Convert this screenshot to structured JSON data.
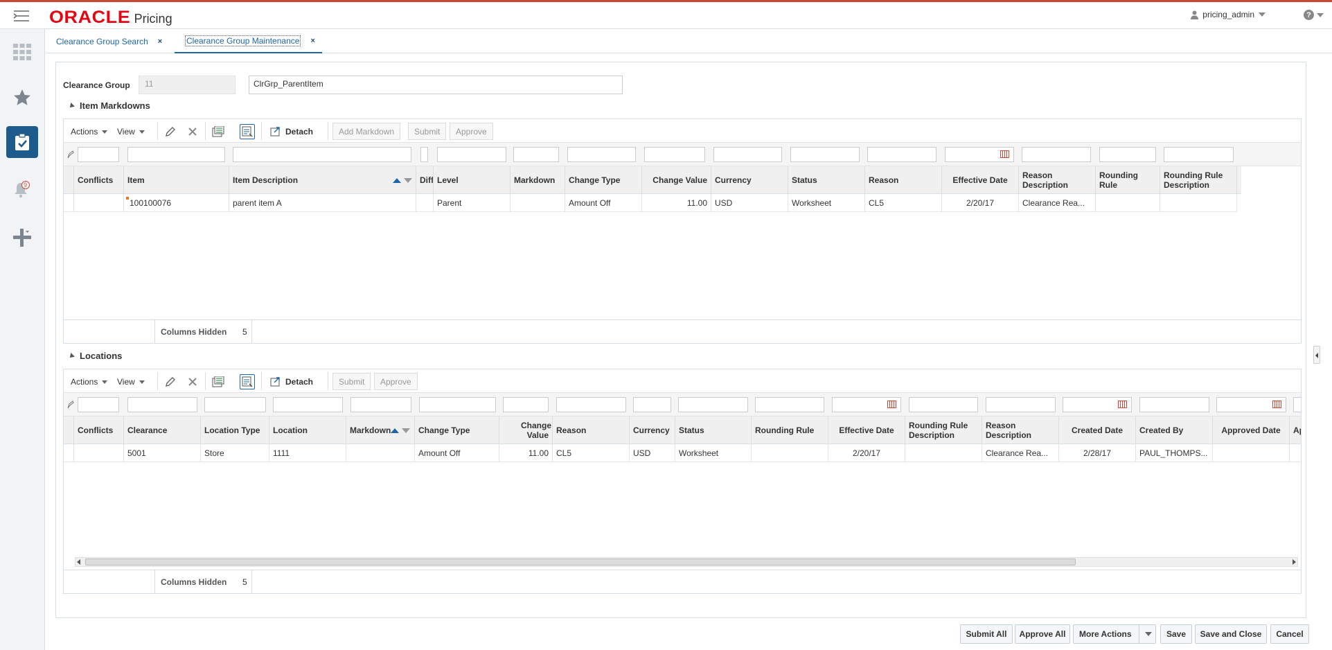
{
  "header": {
    "brand": "ORACLE",
    "app_name": "Pricing",
    "user": "pricing_admin",
    "help": "?"
  },
  "sidenav": {
    "notification_count": "9"
  },
  "tabs": [
    {
      "label": "Clearance Group Search",
      "close": "×"
    },
    {
      "label": "Clearance Group Maintenance",
      "close": "×"
    }
  ],
  "form": {
    "label": "Clearance Group",
    "id_value": "11",
    "name_value": "ClrGrp_ParentItem"
  },
  "item_markdowns": {
    "title": "Item Markdowns",
    "toolbar": {
      "actions": "Actions",
      "view": "View",
      "detach": "Detach",
      "add_markdown": "Add Markdown",
      "submit": "Submit",
      "approve": "Approve"
    },
    "columns": [
      "Conflicts",
      "Item",
      "Item Description",
      "Diff",
      "Level",
      "Markdown",
      "Change Type",
      "Change Value",
      "Currency",
      "Status",
      "Reason",
      "Effective Date",
      "Reason Description",
      "Rounding Rule",
      "Rounding Rule Description"
    ],
    "rows": [
      {
        "conflicts": "",
        "item": "100100076",
        "item_description": "parent item A",
        "diff": "",
        "level": "Parent",
        "markdown": "",
        "change_type": "Amount Off",
        "change_value": "11.00",
        "currency": "USD",
        "status": "Worksheet",
        "reason": "CL5",
        "effective_date": "2/20/17",
        "reason_description": "Clearance Rea...",
        "rounding_rule": "",
        "rounding_rule_description": ""
      }
    ],
    "footer": {
      "label": "Columns Hidden",
      "value": "5"
    }
  },
  "locations": {
    "title": "Locations",
    "toolbar": {
      "actions": "Actions",
      "view": "View",
      "detach": "Detach",
      "submit": "Submit",
      "approve": "Approve"
    },
    "columns": [
      "Conflicts",
      "Clearance",
      "Location Type",
      "Location",
      "Markdown",
      "Change Type",
      "Change Value",
      "Reason",
      "Currency",
      "Status",
      "Rounding Rule",
      "Effective Date",
      "Rounding Rule Description",
      "Reason Description",
      "Created Date",
      "Created By",
      "Approved Date",
      "App"
    ],
    "rows": [
      {
        "conflicts": "",
        "clearance": "5001",
        "location_type": "Store",
        "location": "1111",
        "markdown": "",
        "change_type": "Amount Off",
        "change_value": "11.00",
        "reason": "CL5",
        "currency": "USD",
        "status": "Worksheet",
        "rounding_rule": "",
        "effective_date": "2/20/17",
        "rounding_rule_description": "",
        "reason_description": "Clearance Rea...",
        "created_date": "2/28/17",
        "created_by": "PAUL_THOMPS...",
        "approved_date": "",
        "app": ""
      }
    ],
    "footer": {
      "label": "Columns Hidden",
      "value": "5"
    }
  },
  "buttons": {
    "submit_all": "Submit All",
    "approve_all": "Approve All",
    "more_actions": "More Actions",
    "save": "Save",
    "save_and_close": "Save and Close",
    "cancel": "Cancel"
  },
  "colors": {
    "oracle_red": "#e30613",
    "accent_blue": "#1c5b8c",
    "link_blue": "#1e66a8"
  }
}
